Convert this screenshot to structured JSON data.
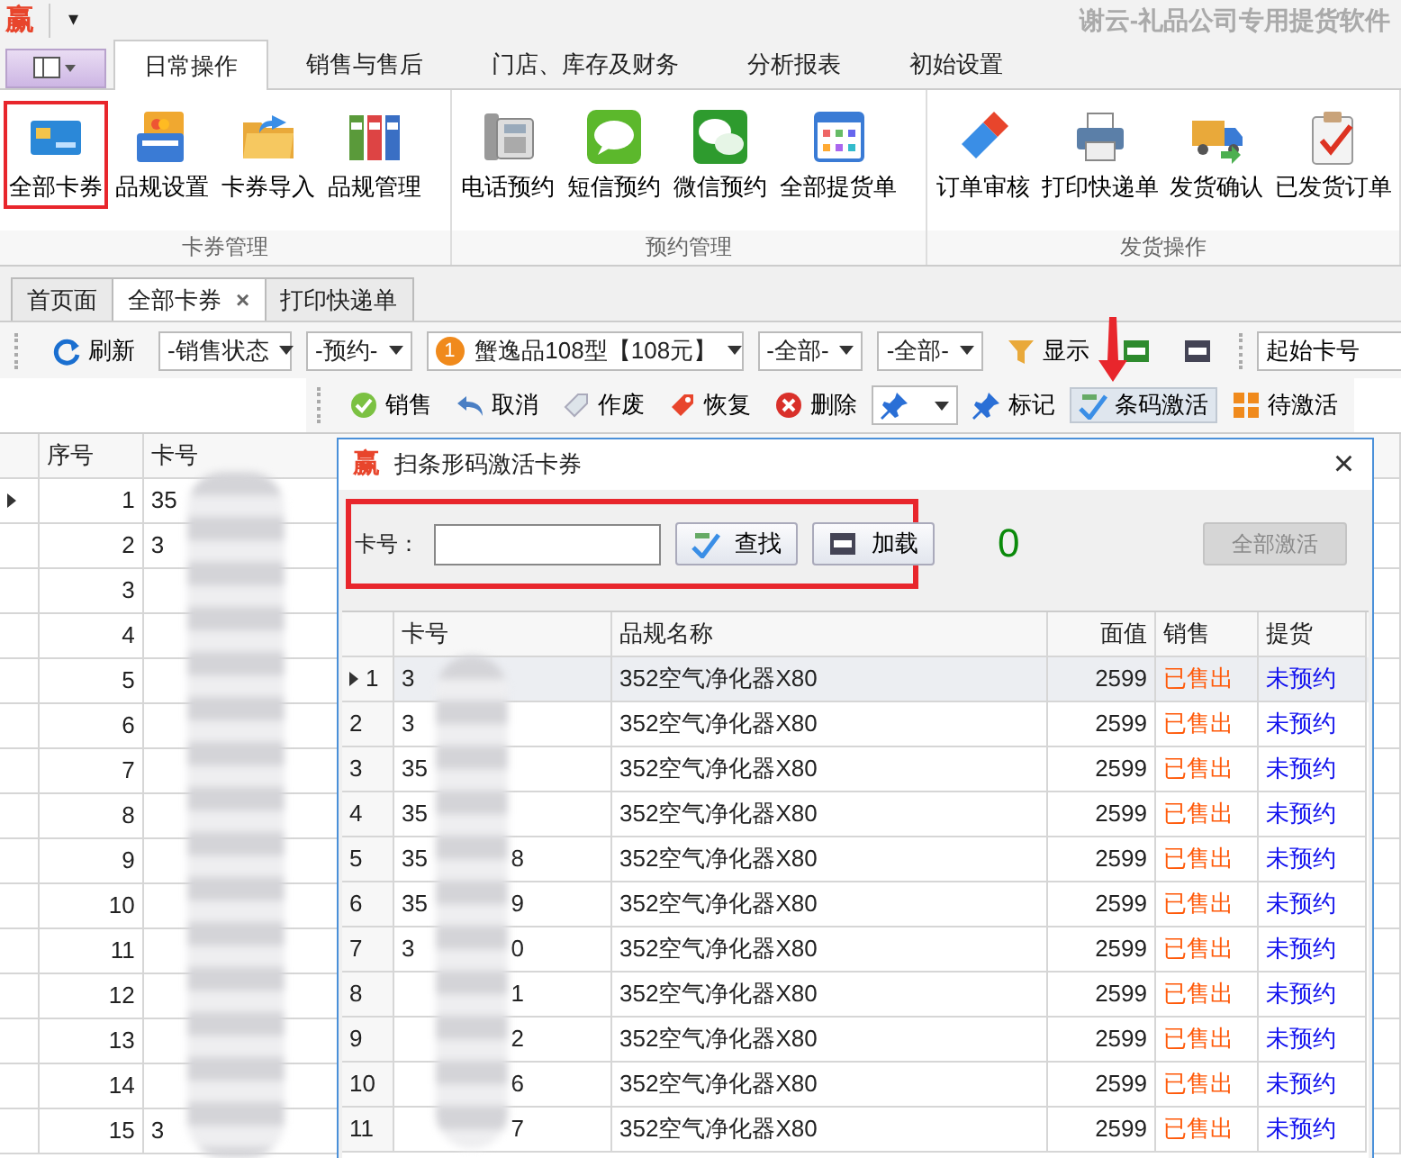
{
  "app": {
    "logo": "赢",
    "quick_access": "▾",
    "title": "谢云-礼品公司专用提货软件"
  },
  "ribbon_tabs": [
    {
      "label": "日常操作",
      "selected": true
    },
    {
      "label": "销售与售后",
      "selected": false
    },
    {
      "label": "门店、库存及财务",
      "selected": false
    },
    {
      "label": "分析报表",
      "selected": false
    },
    {
      "label": "初始设置",
      "selected": false
    }
  ],
  "ribbon_groups": [
    {
      "label": "卡券管理",
      "buttons": [
        {
          "label": "全部卡券",
          "highlighted": true
        },
        {
          "label": "品规设置",
          "highlighted": false
        },
        {
          "label": "卡券导入",
          "highlighted": false
        },
        {
          "label": "品规管理",
          "highlighted": false
        }
      ]
    },
    {
      "label": "预约管理",
      "buttons": [
        {
          "label": "电话预约",
          "highlighted": false
        },
        {
          "label": "短信预约",
          "highlighted": false
        },
        {
          "label": "微信预约",
          "highlighted": false
        },
        {
          "label": "全部提货单",
          "highlighted": false
        }
      ]
    },
    {
      "label": "发货操作",
      "buttons": [
        {
          "label": "订单审核",
          "highlighted": false
        },
        {
          "label": "打印快递单",
          "highlighted": false
        },
        {
          "label": "发货确认",
          "highlighted": false
        },
        {
          "label": "已发货订单",
          "highlighted": false
        }
      ]
    }
  ],
  "doc_tabs": [
    {
      "label": "首页面",
      "selected": false
    },
    {
      "label": "全部卡券",
      "selected": true,
      "close": "×"
    },
    {
      "label": "打印快递单",
      "selected": false
    }
  ],
  "filter_toolbar": [
    {
      "kind": "button",
      "label": "刷新"
    },
    {
      "kind": "dropdown",
      "label": "-销售状态"
    },
    {
      "kind": "dropdown",
      "label": "-预约-"
    },
    {
      "kind": "product",
      "badge": "1",
      "label": "蟹逸品108型【108元】"
    },
    {
      "kind": "dropdown",
      "label": "-全部-"
    },
    {
      "kind": "dropdown",
      "label": "-全部-"
    },
    {
      "kind": "button",
      "label": "显示"
    },
    {
      "kind": "field",
      "label": "起始卡号"
    }
  ],
  "action_toolbar": [
    {
      "label": "销售",
      "hover": false
    },
    {
      "label": "取消",
      "hover": false
    },
    {
      "label": "作废",
      "hover": false
    },
    {
      "label": "恢复",
      "hover": false
    },
    {
      "label": "删除",
      "hover": false
    },
    {
      "label": "标记",
      "hover": false
    },
    {
      "label": "条码激活",
      "hover": true
    },
    {
      "label": "待激活",
      "hover": false
    }
  ],
  "annotation_arrow": true,
  "main_grid": {
    "columns": [
      "序号",
      "卡号"
    ],
    "rows": [
      {
        "index": "1",
        "card": "35",
        "current": true
      },
      {
        "index": "2",
        "card": "3",
        "current": false
      },
      {
        "index": "3",
        "current": false
      },
      {
        "index": "4",
        "current": false
      },
      {
        "index": "5",
        "current": false
      },
      {
        "index": "6",
        "current": false
      },
      {
        "index": "7",
        "current": false
      },
      {
        "index": "8",
        "current": false
      },
      {
        "index": "9",
        "current": false
      },
      {
        "index": "10",
        "current": false
      },
      {
        "index": "11",
        "current": false
      },
      {
        "index": "12",
        "current": false
      },
      {
        "index": "13",
        "current": false
      },
      {
        "index": "14",
        "current": false
      },
      {
        "index": "15",
        "card": "3",
        "current": false
      }
    ]
  },
  "dialog": {
    "logo": "赢",
    "title": "扫条形码激活卡券",
    "close": "×",
    "card_label": "卡号：",
    "search_button": "查找",
    "load_button": "加载",
    "search_highlighted": true,
    "count": "0",
    "activate_all": {
      "label": "全部激活",
      "disabled": true
    },
    "columns": [
      "卡号",
      "品规名称",
      "面值",
      "销售",
      "提货"
    ],
    "rows": [
      {
        "row": "1",
        "card": "3",
        "product": "352空气净化器X80",
        "value": "2599",
        "sale": "已售出",
        "pickup": "未预约",
        "current": true
      },
      {
        "row": "2",
        "card": "3",
        "product": "352空气净化器X80",
        "value": "2599",
        "sale": "已售出",
        "pickup": "未预约",
        "current": false
      },
      {
        "row": "3",
        "card": "35",
        "product": "352空气净化器X80",
        "value": "2599",
        "sale": "已售出",
        "pickup": "未预约",
        "current": false
      },
      {
        "row": "4",
        "card": "35",
        "product": "352空气净化器X80",
        "value": "2599",
        "sale": "已售出",
        "pickup": "未预约",
        "current": false
      },
      {
        "row": "5",
        "card": "35",
        "card_end": "8",
        "product": "352空气净化器X80",
        "value": "2599",
        "sale": "已售出",
        "pickup": "未预约",
        "current": false
      },
      {
        "row": "6",
        "card": "35",
        "card_end": "9",
        "product": "352空气净化器X80",
        "value": "2599",
        "sale": "已售出",
        "pickup": "未预约",
        "current": false
      },
      {
        "row": "7",
        "card": "3",
        "card_end": "0",
        "product": "352空气净化器X80",
        "value": "2599",
        "sale": "已售出",
        "pickup": "未预约",
        "current": false
      },
      {
        "row": "8",
        "card_end": "1",
        "product": "352空气净化器X80",
        "value": "2599",
        "sale": "已售出",
        "pickup": "未预约",
        "current": false
      },
      {
        "row": "9",
        "card_end": "2",
        "product": "352空气净化器X80",
        "value": "2599",
        "sale": "已售出",
        "pickup": "未预约",
        "current": false
      },
      {
        "row": "10",
        "card_end": "6",
        "product": "352空气净化器X80",
        "value": "2599",
        "sale": "已售出",
        "pickup": "未预约",
        "current": false
      },
      {
        "row": "11",
        "card_end": "7",
        "product": "352空气净化器X80",
        "value": "2599",
        "sale": "已售出",
        "pickup": "未预约",
        "current": false
      }
    ]
  }
}
